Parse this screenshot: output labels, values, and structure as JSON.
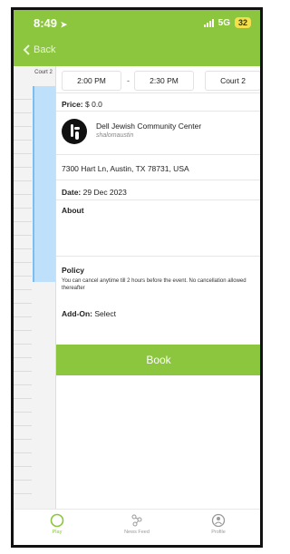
{
  "status": {
    "time": "8:49",
    "network": "5G",
    "battery": "32"
  },
  "nav": {
    "back_label": "Back"
  },
  "calendar": {
    "column_header": "Court 2"
  },
  "booking": {
    "start_time": "2:00 PM",
    "separator": "-",
    "end_time": "2:30 PM",
    "court": "Court 2",
    "price_label": "Price:",
    "price_value": "$ 0.0",
    "venue_name": "Dell Jewish Community Center",
    "venue_handle": "shalomaustin",
    "address": "7300 Hart Ln, Austin, TX 78731, USA",
    "date_label": "Date:",
    "date_value": "29 Dec 2023",
    "about_label": "About",
    "policy_label": "Policy",
    "policy_text": "You can cancel anytime till 2 hours before the event. No cancellation allowed thereafter",
    "addon_label": "Add-On:",
    "addon_value": "Select",
    "book_label": "Book"
  },
  "tabs": [
    {
      "label": "Play",
      "icon": "ring-icon",
      "active": true
    },
    {
      "label": "News Feed",
      "icon": "nodes-icon",
      "active": false
    },
    {
      "label": "Profile",
      "icon": "profile-icon",
      "active": false
    }
  ],
  "colors": {
    "accent": "#8cc63f",
    "calendar_selection": "#bfe0fb"
  }
}
